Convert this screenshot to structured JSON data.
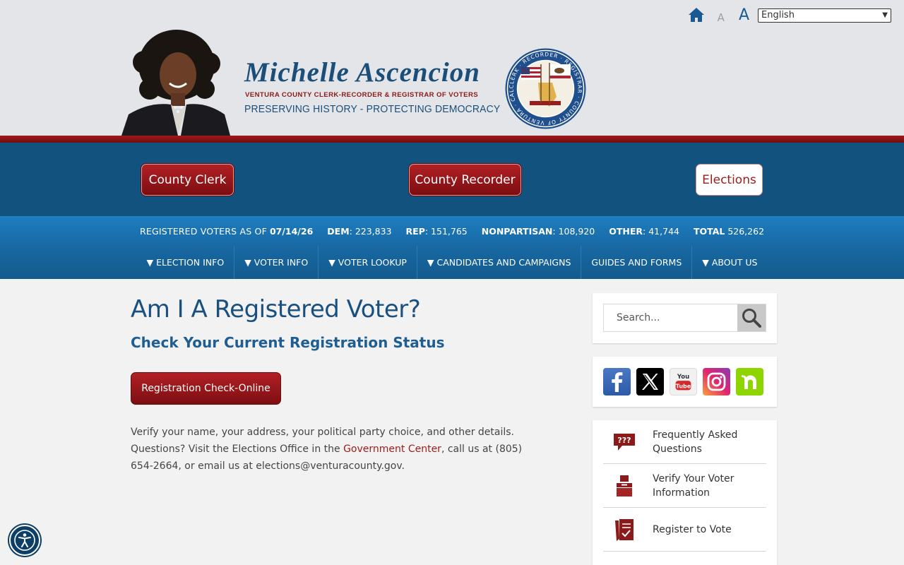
{
  "header": {
    "brand_name": "Michelle Ascencion",
    "brand_title": "VENTURA COUNTY CLERK-RECORDER & REGISTRAR OF VOTERS",
    "brand_tagline": "PRESERVING HISTORY - PROTECTING DEMOCRACY",
    "font_small": "A",
    "font_large": "A",
    "language": "English",
    "seal_text": "CLERK · RECORDER · REGISTRAR · COUNTY OF VENTURA · CALIFORNIA"
  },
  "departments": [
    {
      "label": "County Clerk"
    },
    {
      "label": "County Recorder"
    },
    {
      "label": "Elections"
    }
  ],
  "stats": {
    "label": "REGISTERED VOTERS AS OF",
    "date": "07/14/26",
    "dem_label": "DEM",
    "dem": "223,833",
    "rep_label": "REP",
    "rep": "151,765",
    "np_label": "NONPARTISAN",
    "np": "108,920",
    "other_label": "OTHER",
    "other": "41,744",
    "total_label": "TOTAL",
    "total": "526,262"
  },
  "nav": [
    {
      "label": "▼ ELECTION INFO"
    },
    {
      "label": "▼ VOTER INFO"
    },
    {
      "label": "▼ VOTER LOOKUP"
    },
    {
      "label": "▼ CANDIDATES AND CAMPAIGNS"
    },
    {
      "label": "GUIDES AND FORMS"
    },
    {
      "label": "▼ ABOUT US"
    }
  ],
  "main": {
    "title": "Am I A Registered Voter?",
    "subtitle": "Check Your Current Registration Status",
    "cta_label": "Registration Check-Online",
    "body_1": "Verify your name, your address, your political party choice, and other details. Questions? Visit the Elections Office in the ",
    "body_link": "Government Center",
    "body_2": ", call us at (805) 654-2664, or email us at elections@venturacounty.gov."
  },
  "sidebar": {
    "search_placeholder": "Search...",
    "social": [
      "facebook",
      "x",
      "youtube",
      "instagram",
      "nextdoor"
    ],
    "links": [
      {
        "label": "Frequently Asked Questions"
      },
      {
        "label": "Verify Your Voter Information"
      },
      {
        "label": "Register to Vote"
      }
    ]
  },
  "colors": {
    "navy": "#11527e",
    "red": "#9b1c1c",
    "blue": "#1869a4"
  }
}
